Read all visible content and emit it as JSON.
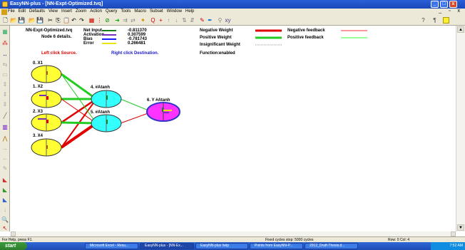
{
  "window": {
    "title": "EasyNN-plus - [NN-Expt-Optimized.tvq]",
    "minimize": "_",
    "maximize": "□",
    "close": "x"
  },
  "menu": [
    "File",
    "Edit",
    "Defaults",
    "View",
    "Insert",
    "Zoom",
    "Action",
    "Query",
    "Tools",
    "Macro",
    "Subset",
    "Window",
    "Help"
  ],
  "mdi_controls": "_ ▫ x",
  "info": {
    "file_name": "NN-Expt-Optimized.tvq",
    "node_details": "Node 6 details.",
    "left_click": "Left click Source.",
    "right_click": "Right click Destination.",
    "net_input_label": "Net Input",
    "net_input_value": "-0.811370",
    "activation_label": "Activation",
    "activation_value": "0.307599",
    "bias_label": "Bias",
    "bias_value": "-0.781743",
    "error_label": "Error",
    "error_value": "0.266481",
    "net_input_color": "#1a7f1a",
    "activation_color": "#7b2fbf",
    "bias_color": "#1a1aff",
    "error_color": "#e6e600"
  },
  "legend": {
    "negative_weight": "Negative Weight",
    "positive_weight": "Positive Weight",
    "insignificant_weight": "Insignificant Weight",
    "function_label": "Function:",
    "function_value": "enabled",
    "negative_feedback": "Negative feedback",
    "positive_feedback": "Positive feedback",
    "negative_color": "#e00000",
    "positive_color": "#22cc22",
    "negative_feedback_color": "#ff9999",
    "positive_feedback_color": "#99ff99"
  },
  "nodes": [
    {
      "label": "0. X1"
    },
    {
      "label": "1. X2"
    },
    {
      "label": "2. X3"
    },
    {
      "label": "3. X4"
    },
    {
      "label": "4. #Atanh"
    },
    {
      "label": "5. #Atanh"
    },
    {
      "label": "6. Y #Atanh"
    }
  ],
  "colors": {
    "input_fill": "#ffff33",
    "hidden_fill": "#33ffff",
    "output_fill": "#ff33ff",
    "output_ring": "#3333cc"
  },
  "status": {
    "help": "For Help, press F1.",
    "cycles": "Fixed cycles stop: 5000 cycles",
    "position": "Row: 0  Col: 4"
  },
  "taskbar": {
    "start": "start",
    "tasks": [
      "Microsoft Excel - Resu...",
      "EasyNN-plus - [NN-Ex...",
      "EasyNN-plus help",
      "Points from EasyNN-P...",
      "2012_Draft-Thesis.d..."
    ],
    "clock": "7:52 AM"
  }
}
